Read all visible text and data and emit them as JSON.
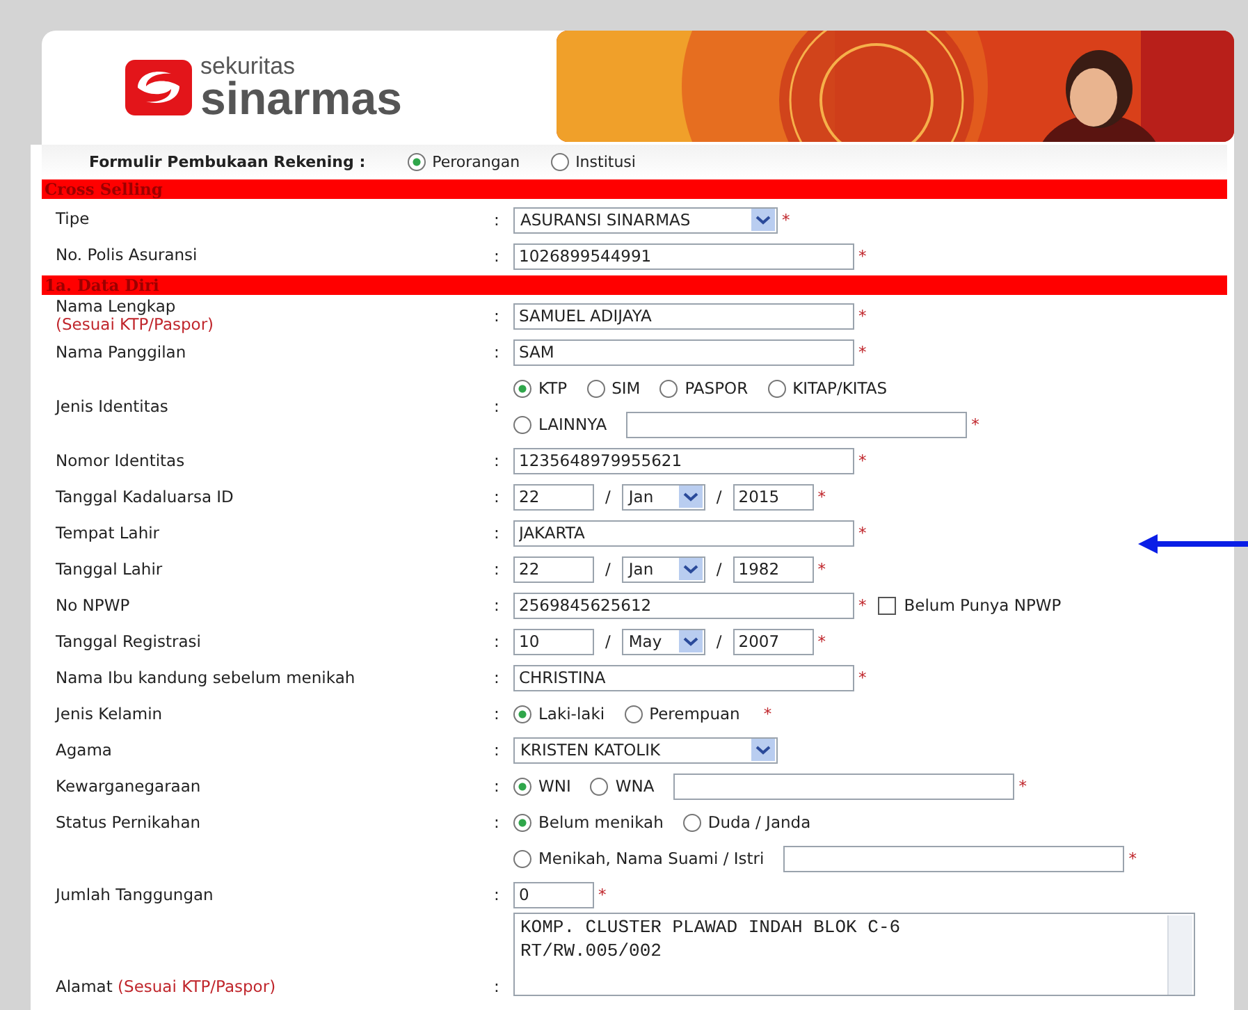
{
  "logo": {
    "line1": "sekuritas",
    "line2": "sinarmas"
  },
  "account_form": {
    "label": "Formulir Pembukaan Rekening :",
    "options": [
      {
        "label": "Perorangan",
        "selected": true
      },
      {
        "label": "Institusi",
        "selected": false
      }
    ]
  },
  "sections": [
    {
      "title": "Cross Selling",
      "rows": [
        {
          "kind": "select",
          "label": "Tipe",
          "colon": ":",
          "value": "ASURANSI SINARMAS",
          "mark": "*"
        },
        {
          "kind": "text",
          "label": "No. Polis Asuransi",
          "colon": ":",
          "value": "1026899544991",
          "mark": "*"
        }
      ]
    },
    {
      "title": "1a. Data Diri",
      "rows": [
        {
          "kind": "text",
          "label": "Nama Lengkap",
          "note": "(Sesuai KTP/Paspor)",
          "colon": ":",
          "value": "SAMUEL ADIJAYA",
          "mark": "*"
        },
        {
          "kind": "text",
          "label": "Nama Panggilan",
          "colon": ":",
          "value": "SAM",
          "mark": "*"
        },
        {
          "kind": "radio",
          "label": "Jenis Identitas",
          "colon": ":",
          "lines": [
            [
              {
                "kind": "option",
                "label": "KTP",
                "selected": true
              },
              {
                "kind": "option",
                "label": "SIM",
                "selected": false
              },
              {
                "kind": "option",
                "label": "PASPOR",
                "selected": false
              },
              {
                "kind": "option",
                "label": "KITAP/KITAS",
                "selected": false
              }
            ],
            [
              {
                "kind": "option",
                "label": "LAINNYA",
                "selected": false
              },
              {
                "kind": "field"
              },
              {
                "kind": "mark",
                "text": "*"
              }
            ]
          ]
        },
        {
          "kind": "text",
          "label": "Nomor Identitas",
          "colon": ":",
          "value": "1235648979955621",
          "mark": "*"
        },
        {
          "kind": "date",
          "label": "Tanggal Kadaluarsa ID",
          "colon": ":",
          "day": "22",
          "month": "Jan",
          "year": "2015",
          "separators": [
            "/",
            "/"
          ],
          "mark": "*"
        },
        {
          "kind": "text",
          "label": "Tempat Lahir",
          "colon": ":",
          "value": "JAKARTA",
          "mark": "*"
        },
        {
          "kind": "date",
          "label": "Tanggal Lahir",
          "colon": ":",
          "day": "22",
          "month": "Jan",
          "year": "1982",
          "separators": [
            "/",
            "/"
          ],
          "mark": "*"
        },
        {
          "kind": "text",
          "label": "No NPWP",
          "colon": ":",
          "value": "2569845625612",
          "mark": "*",
          "checkbox": {
            "label": "Belum Punya NPWP",
            "checked": false
          }
        },
        {
          "kind": "date",
          "label": "Tanggal Registrasi",
          "colon": ":",
          "day": "10",
          "month": "May",
          "year": "2007",
          "separators": [
            "/",
            "/"
          ],
          "mark": "*"
        },
        {
          "kind": "text",
          "label": "Nama Ibu kandung sebelum menikah",
          "colon": ":",
          "value": "CHRISTINA",
          "mark": "*"
        },
        {
          "kind": "radio",
          "label": "Jenis Kelamin",
          "colon": ":",
          "lines": [
            [
              {
                "kind": "option",
                "label": "Laki-laki",
                "selected": true
              },
              {
                "kind": "option",
                "label": "Perempuan",
                "selected": false
              },
              {
                "kind": "mark",
                "text": "*"
              }
            ]
          ]
        },
        {
          "kind": "select",
          "label": "Agama",
          "colon": ":",
          "value": "KRISTEN KATOLIK"
        },
        {
          "kind": "radio",
          "label": "Kewarganegaraan",
          "colon": ":",
          "lines": [
            [
              {
                "kind": "option",
                "label": "WNI",
                "selected": true
              },
              {
                "kind": "option",
                "label": "WNA",
                "selected": false
              },
              {
                "kind": "field"
              },
              {
                "kind": "mark",
                "text": "*"
              }
            ]
          ]
        },
        {
          "kind": "radio",
          "label": "Status Pernikahan",
          "colon": ":",
          "lines": [
            [
              {
                "kind": "option",
                "label": "Belum menikah",
                "selected": true
              },
              {
                "kind": "option",
                "label": "Duda / Janda",
                "selected": false
              }
            ]
          ]
        },
        {
          "kind": "radio",
          "lines": [
            [
              {
                "kind": "option",
                "label": "Menikah, Nama Suami / Istri",
                "selected": false
              },
              {
                "kind": "field"
              },
              {
                "kind": "mark",
                "text": "*"
              }
            ]
          ]
        },
        {
          "kind": "number",
          "label": "Jumlah Tanggungan",
          "colon": ":",
          "value": "0",
          "mark": "*"
        },
        {
          "kind": "textarea",
          "label": "Alamat",
          "note": "(Sesuai KTP/Paspor)",
          "colon": ":",
          "value": "KOMP. CLUSTER PLAWAD INDAH BLOK C-6\nRT/RW.005/002"
        }
      ]
    }
  ]
}
